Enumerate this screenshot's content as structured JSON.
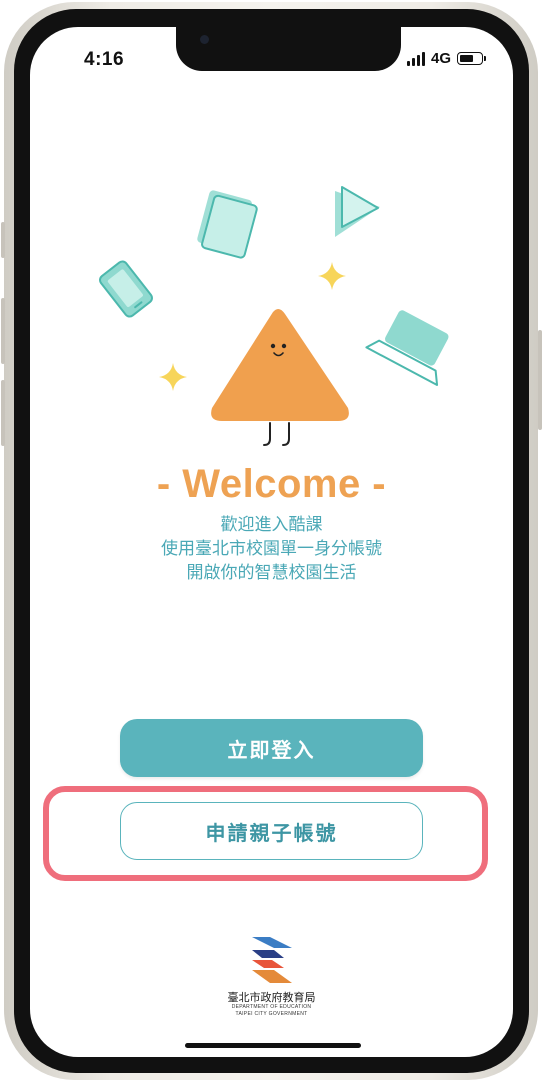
{
  "status_bar": {
    "time": "4:16",
    "network": "4G"
  },
  "welcome": {
    "title": "- Welcome -",
    "lines": [
      "歡迎進入酷課",
      "使用臺北市校園單一身分帳號",
      "開啟你的智慧校園生活"
    ]
  },
  "buttons": {
    "login": "立即登入",
    "parent_account": "申請親子帳號"
  },
  "footer": {
    "org_name": "臺北市政府教育局",
    "org_en_1": "DEPARTMENT OF EDUCATION",
    "org_en_2": "TAIPEI CITY GOVERNMENT"
  },
  "colors": {
    "accent_teal": "#5ab4bc",
    "welcome_orange": "#eea253",
    "highlight_pink": "#ef6e7c",
    "mascot_orange": "#f0a04e",
    "icon_teal": "#8fd9cf",
    "sparkle_yellow": "#f7d55a"
  },
  "icons": [
    "tablet-icon",
    "phone-icon",
    "play-icon",
    "laptop-icon",
    "sparkle-icon",
    "triangle-mascot"
  ]
}
